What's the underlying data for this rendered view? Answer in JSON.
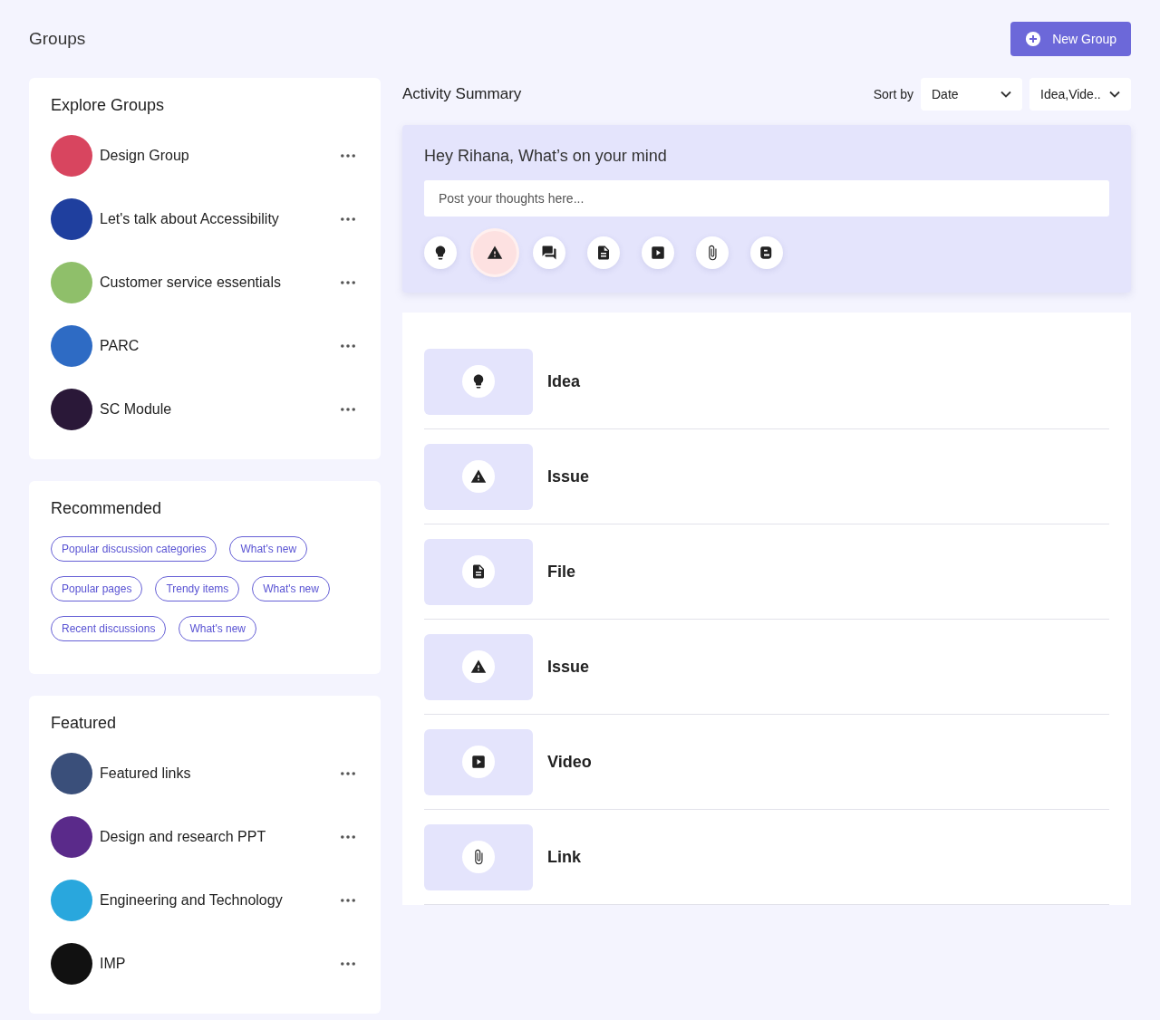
{
  "header": {
    "title": "Groups",
    "new_button": "New Group"
  },
  "explore": {
    "title": "Explore Groups",
    "groups": [
      {
        "name": "Design Group"
      },
      {
        "name": "Let's talk about Accessibility"
      },
      {
        "name": "Customer service essentials"
      },
      {
        "name": "PARC"
      },
      {
        "name": "SC Module"
      }
    ]
  },
  "recommended": {
    "title": "Recommended",
    "tags": [
      [
        "Popular discussion categories",
        "What's new"
      ],
      [
        "Popular pages",
        "Trendy items",
        "What's new"
      ],
      [
        "Recent discussions",
        "What's new"
      ]
    ]
  },
  "featured": {
    "title": "Featured",
    "groups": [
      {
        "name": "Featured links"
      },
      {
        "name": "Design and research PPT"
      },
      {
        "name": "Engineering and Technology"
      },
      {
        "name": "IMP"
      }
    ]
  },
  "activity": {
    "title": "Activity Summary",
    "sort_label": "Sort by",
    "sort_value": "Date",
    "filter_value": "Idea,Vide.."
  },
  "composer": {
    "greeting": "Hey Rihana, What’s on your mind",
    "placeholder": "Post your thoughts here...",
    "post_types": [
      {
        "kind": "idea",
        "selected": false
      },
      {
        "kind": "issue",
        "selected": true
      },
      {
        "kind": "discussion",
        "selected": false
      },
      {
        "kind": "file",
        "selected": false
      },
      {
        "kind": "video",
        "selected": false
      },
      {
        "kind": "link",
        "selected": false
      },
      {
        "kind": "blog",
        "selected": false
      }
    ]
  },
  "feed": [
    {
      "kind": "idea",
      "label": "Idea"
    },
    {
      "kind": "issue",
      "label": "Issue"
    },
    {
      "kind": "file",
      "label": "File"
    },
    {
      "kind": "issue",
      "label": "Issue"
    },
    {
      "kind": "video",
      "label": "Video"
    },
    {
      "kind": "link",
      "label": "Link"
    }
  ]
}
